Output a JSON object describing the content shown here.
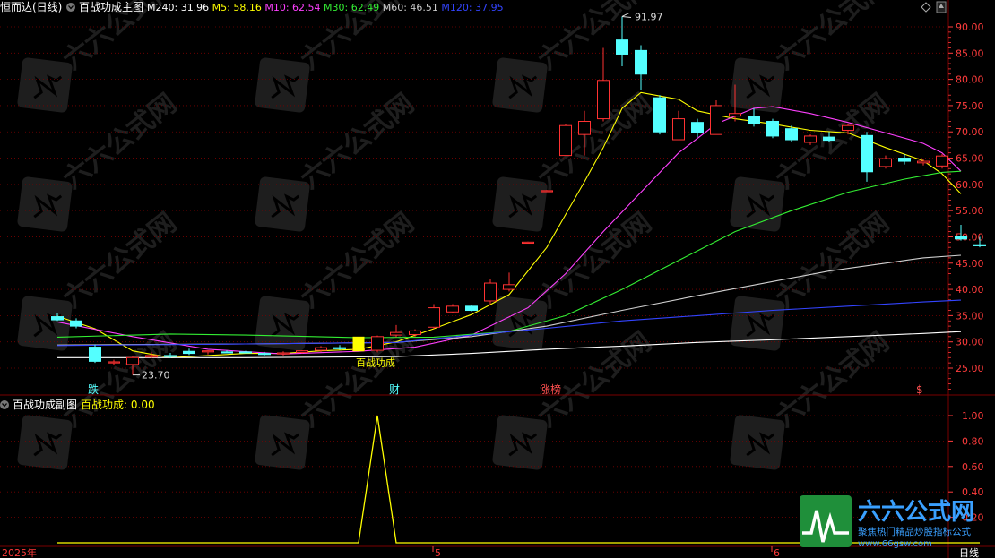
{
  "header": {
    "stock_name": "恒而达(日线)",
    "main_title": "百战功成主图",
    "ma": [
      {
        "label": "M240",
        "value": "31.96",
        "color": "#ffffff"
      },
      {
        "label": "M5",
        "value": "58.16",
        "color": "#ffff00"
      },
      {
        "label": "M10",
        "value": "62.54",
        "color": "#ff40ff"
      },
      {
        "label": "M30",
        "value": "62.49",
        "color": "#33ee33"
      },
      {
        "label": "M60",
        "value": "46.51",
        "color": "#cccccc"
      },
      {
        "label": "M120",
        "value": "37.95",
        "color": "#3344ff"
      }
    ]
  },
  "sub_header": {
    "title": "百战功成副图",
    "indicator_label": "百战功成",
    "indicator_value": "0.00"
  },
  "colors": {
    "up": "#ff3232",
    "down": "#54ffff",
    "grid": "#7a0000",
    "axis_text": "#ff3c3c",
    "signal": "#ffff00"
  },
  "chart_data": [
    {
      "type": "candlestick",
      "title": "百战功成主图",
      "ylim": [
        22,
        96
      ],
      "y_ticks": [
        "90.00",
        "85.00",
        "80.00",
        "75.00",
        "70.00",
        "65.00",
        "60.00",
        "55.00",
        "50.00",
        "45.00",
        "40.00",
        "35.00",
        "30.00",
        "25.00"
      ],
      "y_tick_values": [
        90,
        85,
        80,
        75,
        70,
        65,
        60,
        55,
        50,
        45,
        40,
        35,
        30,
        25
      ],
      "max_annotation": "91.97",
      "min_annotation": "23.70",
      "signal_label": "百战功成",
      "marker_labels": [
        {
          "text": "跌",
          "index": 2,
          "color": "#54ffff"
        },
        {
          "text": "财",
          "index": 18,
          "color": "#54ffff"
        },
        {
          "text": "涨榜",
          "index": 26,
          "color": "#ff5050"
        },
        {
          "text": "$",
          "index": 46,
          "color": "#ff5050"
        }
      ],
      "x_labels": [
        {
          "text": "2025年",
          "index": 0
        },
        {
          "text": "5",
          "index": 20
        },
        {
          "text": "6",
          "index": 38
        }
      ],
      "period_label": "日线",
      "candles": [
        {
          "o": 34.8,
          "h": 35.5,
          "l": 34.0,
          "c": 34.2
        },
        {
          "o": 34.0,
          "h": 34.5,
          "l": 32.6,
          "c": 33.0
        },
        {
          "o": 29.0,
          "h": 29.5,
          "l": 26.0,
          "c": 26.3
        },
        {
          "o": 26.0,
          "h": 26.6,
          "l": 25.6,
          "c": 26.2
        },
        {
          "o": 25.7,
          "h": 27.3,
          "l": 23.7,
          "c": 27.0
        },
        {
          "o": 27.1,
          "h": 28.0,
          "l": 26.9,
          "c": 27.4
        },
        {
          "o": 27.4,
          "h": 27.9,
          "l": 26.9,
          "c": 27.3
        },
        {
          "o": 28.2,
          "h": 28.7,
          "l": 27.5,
          "c": 27.8
        },
        {
          "o": 28.1,
          "h": 28.4,
          "l": 27.6,
          "c": 28.3
        },
        {
          "o": 28.1,
          "h": 28.4,
          "l": 27.9,
          "c": 28.0
        },
        {
          "o": 28.1,
          "h": 28.3,
          "l": 27.8,
          "c": 28.0
        },
        {
          "o": 27.8,
          "h": 28.1,
          "l": 27.4,
          "c": 27.6
        },
        {
          "o": 27.7,
          "h": 28.2,
          "l": 27.4,
          "c": 27.9
        },
        {
          "o": 28.0,
          "h": 28.4,
          "l": 27.8,
          "c": 28.3
        },
        {
          "o": 28.4,
          "h": 29.2,
          "l": 28.1,
          "c": 28.9
        },
        {
          "o": 28.9,
          "h": 29.4,
          "l": 28.5,
          "c": 28.8
        },
        {
          "o": 28.6,
          "h": 29.0,
          "l": 28.3,
          "c": 28.6
        },
        {
          "o": 28.4,
          "h": 31.2,
          "l": 28.0,
          "c": 31.0
        },
        {
          "o": 31.3,
          "h": 33.2,
          "l": 30.9,
          "c": 31.8
        },
        {
          "o": 31.4,
          "h": 32.4,
          "l": 31.0,
          "c": 32.1
        },
        {
          "o": 32.8,
          "h": 37.2,
          "l": 32.5,
          "c": 36.5
        },
        {
          "o": 35.7,
          "h": 37.2,
          "l": 35.4,
          "c": 36.8
        },
        {
          "o": 36.8,
          "h": 37.0,
          "l": 35.8,
          "c": 36.0
        },
        {
          "o": 37.8,
          "h": 42.0,
          "l": 37.2,
          "c": 41.2
        },
        {
          "o": 40.0,
          "h": 43.2,
          "l": 39.6,
          "c": 40.9
        },
        {
          "o": 49.0,
          "h": 49.1,
          "l": 48.9,
          "c": 49.0
        },
        {
          "o": 58.8,
          "h": 58.9,
          "l": 58.7,
          "c": 58.8
        },
        {
          "o": 65.5,
          "h": 71.5,
          "l": 65.5,
          "c": 71.2
        },
        {
          "o": 69.5,
          "h": 74.0,
          "l": 65.5,
          "c": 72.0
        },
        {
          "o": 72.5,
          "h": 86.0,
          "l": 72.0,
          "c": 79.8
        },
        {
          "o": 87.5,
          "h": 91.97,
          "l": 82.5,
          "c": 84.8
        },
        {
          "o": 85.5,
          "h": 86.5,
          "l": 78.0,
          "c": 81.0
        },
        {
          "o": 76.5,
          "h": 77.0,
          "l": 69.5,
          "c": 70.0
        },
        {
          "o": 68.5,
          "h": 74.0,
          "l": 68.5,
          "c": 72.5
        },
        {
          "o": 71.8,
          "h": 72.5,
          "l": 69.0,
          "c": 69.8
        },
        {
          "o": 69.5,
          "h": 76.0,
          "l": 69.5,
          "c": 75.0
        },
        {
          "o": 73.0,
          "h": 79.0,
          "l": 72.0,
          "c": 73.5
        },
        {
          "o": 73.0,
          "h": 74.5,
          "l": 71.0,
          "c": 71.5
        },
        {
          "o": 72.0,
          "h": 72.5,
          "l": 68.8,
          "c": 69.2
        },
        {
          "o": 70.6,
          "h": 71.2,
          "l": 68.0,
          "c": 68.5
        },
        {
          "o": 68.0,
          "h": 69.5,
          "l": 67.5,
          "c": 69.2
        },
        {
          "o": 69.0,
          "h": 70.0,
          "l": 68.0,
          "c": 68.4
        },
        {
          "o": 70.3,
          "h": 71.5,
          "l": 69.5,
          "c": 71.2
        },
        {
          "o": 69.3,
          "h": 70.0,
          "l": 60.5,
          "c": 62.4
        },
        {
          "o": 63.4,
          "h": 65.5,
          "l": 63.0,
          "c": 64.9
        },
        {
          "o": 65.0,
          "h": 65.8,
          "l": 63.8,
          "c": 64.4
        },
        {
          "o": 64.1,
          "h": 64.8,
          "l": 63.6,
          "c": 64.4
        },
        {
          "o": 63.5,
          "h": 65.8,
          "l": 63.0,
          "c": 65.4
        },
        {
          "o": 50.0,
          "h": 52.3,
          "l": 49.3,
          "c": 49.6
        },
        {
          "o": 48.5,
          "h": 50.0,
          "l": 48.0,
          "c": 48.4
        }
      ],
      "series": [
        {
          "name": "M5",
          "color": "#ffff00",
          "points": [
            [
              0,
              34.9
            ],
            [
              2,
              32.5
            ],
            [
              4,
              28.3
            ],
            [
              6,
              27.0
            ],
            [
              8,
              27.4
            ],
            [
              10,
              27.8
            ],
            [
              12,
              27.8
            ],
            [
              14,
              28.3
            ],
            [
              16,
              28.6
            ],
            [
              18,
              30.0
            ],
            [
              20,
              32.5
            ],
            [
              22,
              35.2
            ],
            [
              24,
              39.0
            ],
            [
              26,
              48.0
            ],
            [
              28,
              60.5
            ],
            [
              29,
              67.0
            ],
            [
              30,
              74.5
            ],
            [
              31,
              77.5
            ],
            [
              33,
              76.2
            ],
            [
              34,
              74.0
            ],
            [
              36,
              72.5
            ],
            [
              38,
              71.5
            ],
            [
              40,
              70.3
            ],
            [
              42,
              69.8
            ],
            [
              44,
              67.0
            ],
            [
              46,
              64.5
            ],
            [
              47,
              62.0
            ],
            [
              48,
              58.2
            ]
          ]
        },
        {
          "name": "M10",
          "color": "#ff40ff",
          "points": [
            [
              0,
              33.8
            ],
            [
              4,
              31.0
            ],
            [
              8,
              28.6
            ],
            [
              12,
              27.7
            ],
            [
              16,
              28.2
            ],
            [
              19,
              29.0
            ],
            [
              22,
              31.3
            ],
            [
              25,
              36.5
            ],
            [
              27,
              43.0
            ],
            [
              29,
              51.0
            ],
            [
              31,
              58.5
            ],
            [
              33,
              66.0
            ],
            [
              35,
              71.5
            ],
            [
              37,
              74.5
            ],
            [
              38,
              74.8
            ],
            [
              40,
              73.5
            ],
            [
              42,
              71.8
            ],
            [
              44,
              69.8
            ],
            [
              46,
              67.8
            ],
            [
              47,
              66.0
            ],
            [
              48,
              62.5
            ]
          ]
        },
        {
          "name": "M30",
          "color": "#33ee33",
          "points": [
            [
              0,
              30.9
            ],
            [
              6,
              31.5
            ],
            [
              10,
              31.3
            ],
            [
              16,
              30.8
            ],
            [
              20,
              30.9
            ],
            [
              24,
              32.0
            ],
            [
              27,
              35.0
            ],
            [
              30,
              40.0
            ],
            [
              33,
              45.5
            ],
            [
              36,
              51.0
            ],
            [
              39,
              55.0
            ],
            [
              42,
              58.5
            ],
            [
              45,
              61.0
            ],
            [
              47,
              62.3
            ],
            [
              48,
              62.5
            ]
          ]
        },
        {
          "name": "M60",
          "color": "#d0d0d0",
          "points": [
            [
              0,
              29.4
            ],
            [
              10,
              29.6
            ],
            [
              18,
              29.9
            ],
            [
              22,
              31.0
            ],
            [
              26,
              33.0
            ],
            [
              30,
              36.0
            ],
            [
              34,
              38.8
            ],
            [
              38,
              41.5
            ],
            [
              41,
              43.5
            ],
            [
              44,
              45.0
            ],
            [
              46,
              46.0
            ],
            [
              48,
              46.5
            ]
          ]
        },
        {
          "name": "M120",
          "color": "#3344ff",
          "points": [
            [
              0,
              29.3
            ],
            [
              10,
              29.6
            ],
            [
              18,
              29.9
            ],
            [
              22,
              31.3
            ],
            [
              26,
              32.6
            ],
            [
              30,
              34.0
            ],
            [
              34,
              35.0
            ],
            [
              38,
              36.0
            ],
            [
              42,
              36.8
            ],
            [
              46,
              37.6
            ],
            [
              48,
              37.95
            ]
          ]
        },
        {
          "name": "M240",
          "color": "#ffffff",
          "points": [
            [
              0,
              27.0
            ],
            [
              10,
              27.0
            ],
            [
              18,
              27.2
            ],
            [
              22,
              27.8
            ],
            [
              26,
              28.6
            ],
            [
              30,
              29.2
            ],
            [
              34,
              29.9
            ],
            [
              38,
              30.4
            ],
            [
              42,
              31.0
            ],
            [
              46,
              31.6
            ],
            [
              48,
              31.96
            ]
          ]
        }
      ]
    },
    {
      "type": "line",
      "title": "百战功成副图",
      "ylim": [
        0,
        1.08
      ],
      "y_ticks": [
        "1.00",
        "0.80",
        "0.60",
        "0.40",
        "0.20"
      ],
      "y_tick_values": [
        1.0,
        0.8,
        0.6,
        0.4,
        0.2
      ],
      "series": [
        {
          "name": "百战功成",
          "color": "#ffff00",
          "points": [
            [
              0,
              0
            ],
            [
              16,
              0
            ],
            [
              17,
              1
            ],
            [
              18,
              0
            ],
            [
              49,
              0
            ]
          ]
        }
      ]
    }
  ],
  "watermark": {
    "brand": "六六公式网",
    "slogan": "聚焦热门精品炒股指标公式",
    "url": "www.66gsw.com"
  }
}
